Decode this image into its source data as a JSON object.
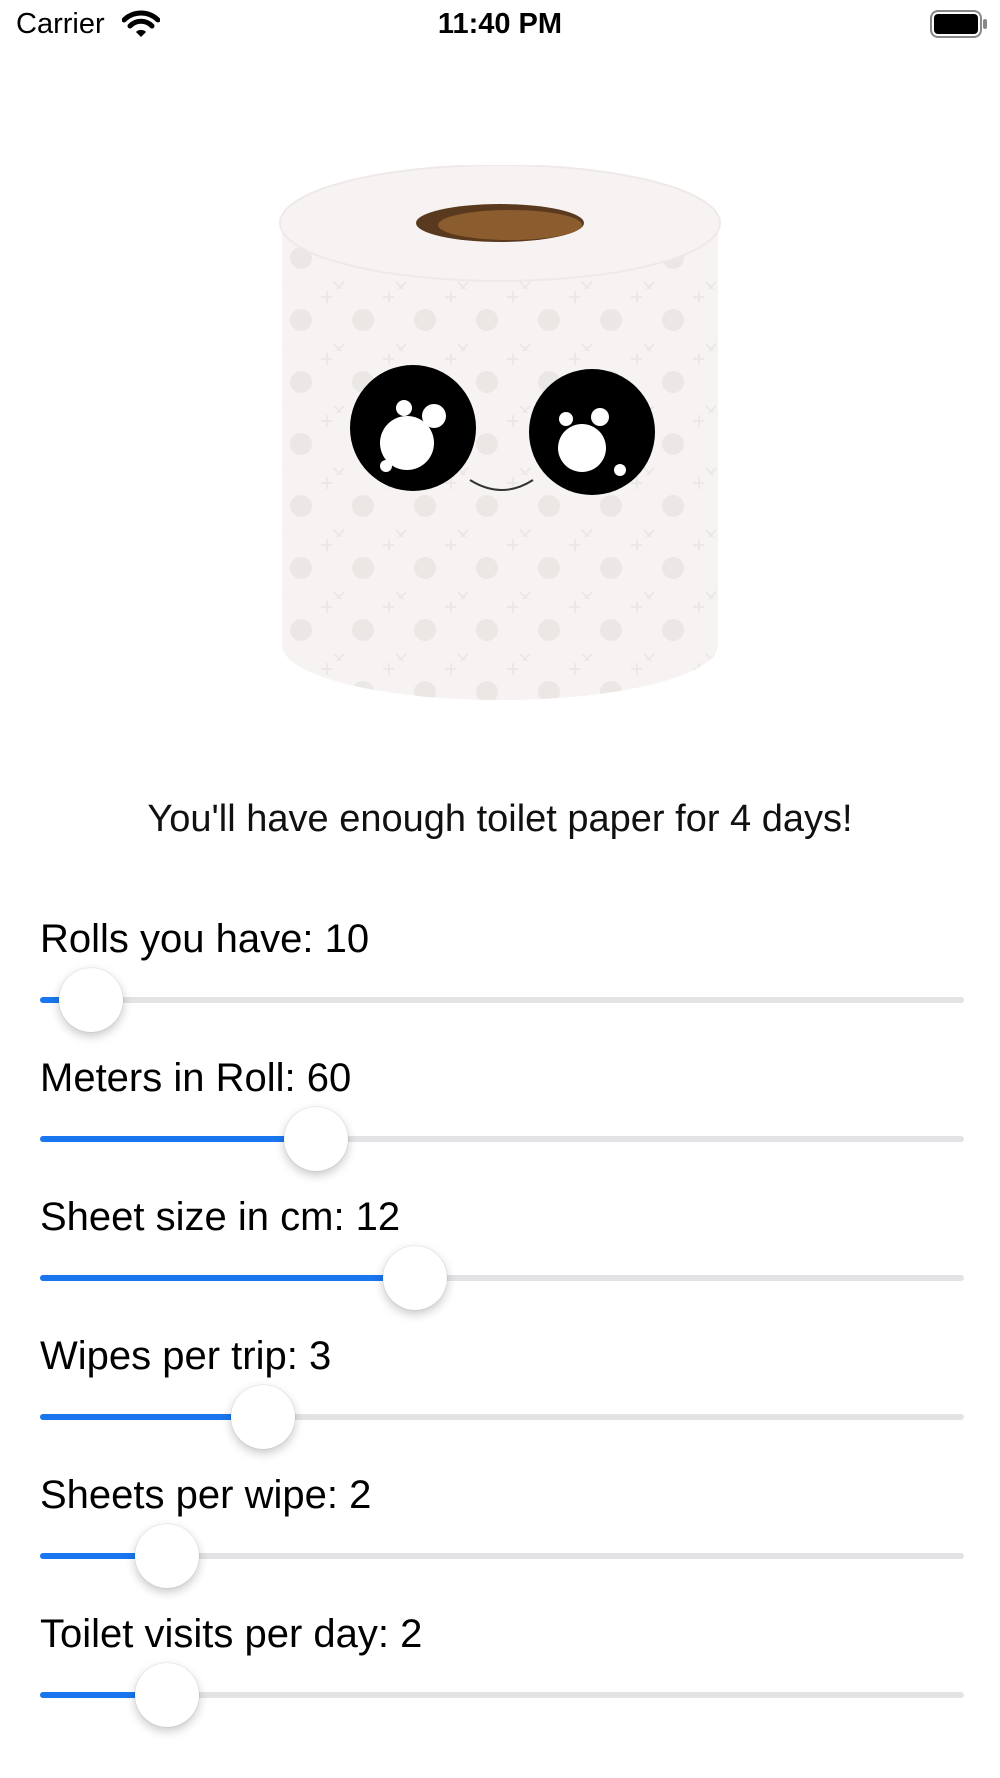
{
  "status_bar": {
    "carrier": "Carrier",
    "time": "11:40 PM"
  },
  "illustration": {
    "icon": "toilet-paper-roll-face-illustration"
  },
  "result_text": "You'll have enough toilet paper for 4 days!",
  "sliders": [
    {
      "label": "Rolls you have: 10",
      "fraction": 0.055
    },
    {
      "label": "Meters in Roll: 60",
      "fraction": 0.299
    },
    {
      "label": "Sheet size in cm: 12",
      "fraction": 0.406
    },
    {
      "label": "Wipes per trip: 3",
      "fraction": 0.241
    },
    {
      "label": "Sheets per wipe: 2",
      "fraction": 0.137
    },
    {
      "label": "Toilet visits per day: 2",
      "fraction": 0.137
    }
  ],
  "colors": {
    "accent": "#1a76ee",
    "track": "#e3e3e6"
  }
}
